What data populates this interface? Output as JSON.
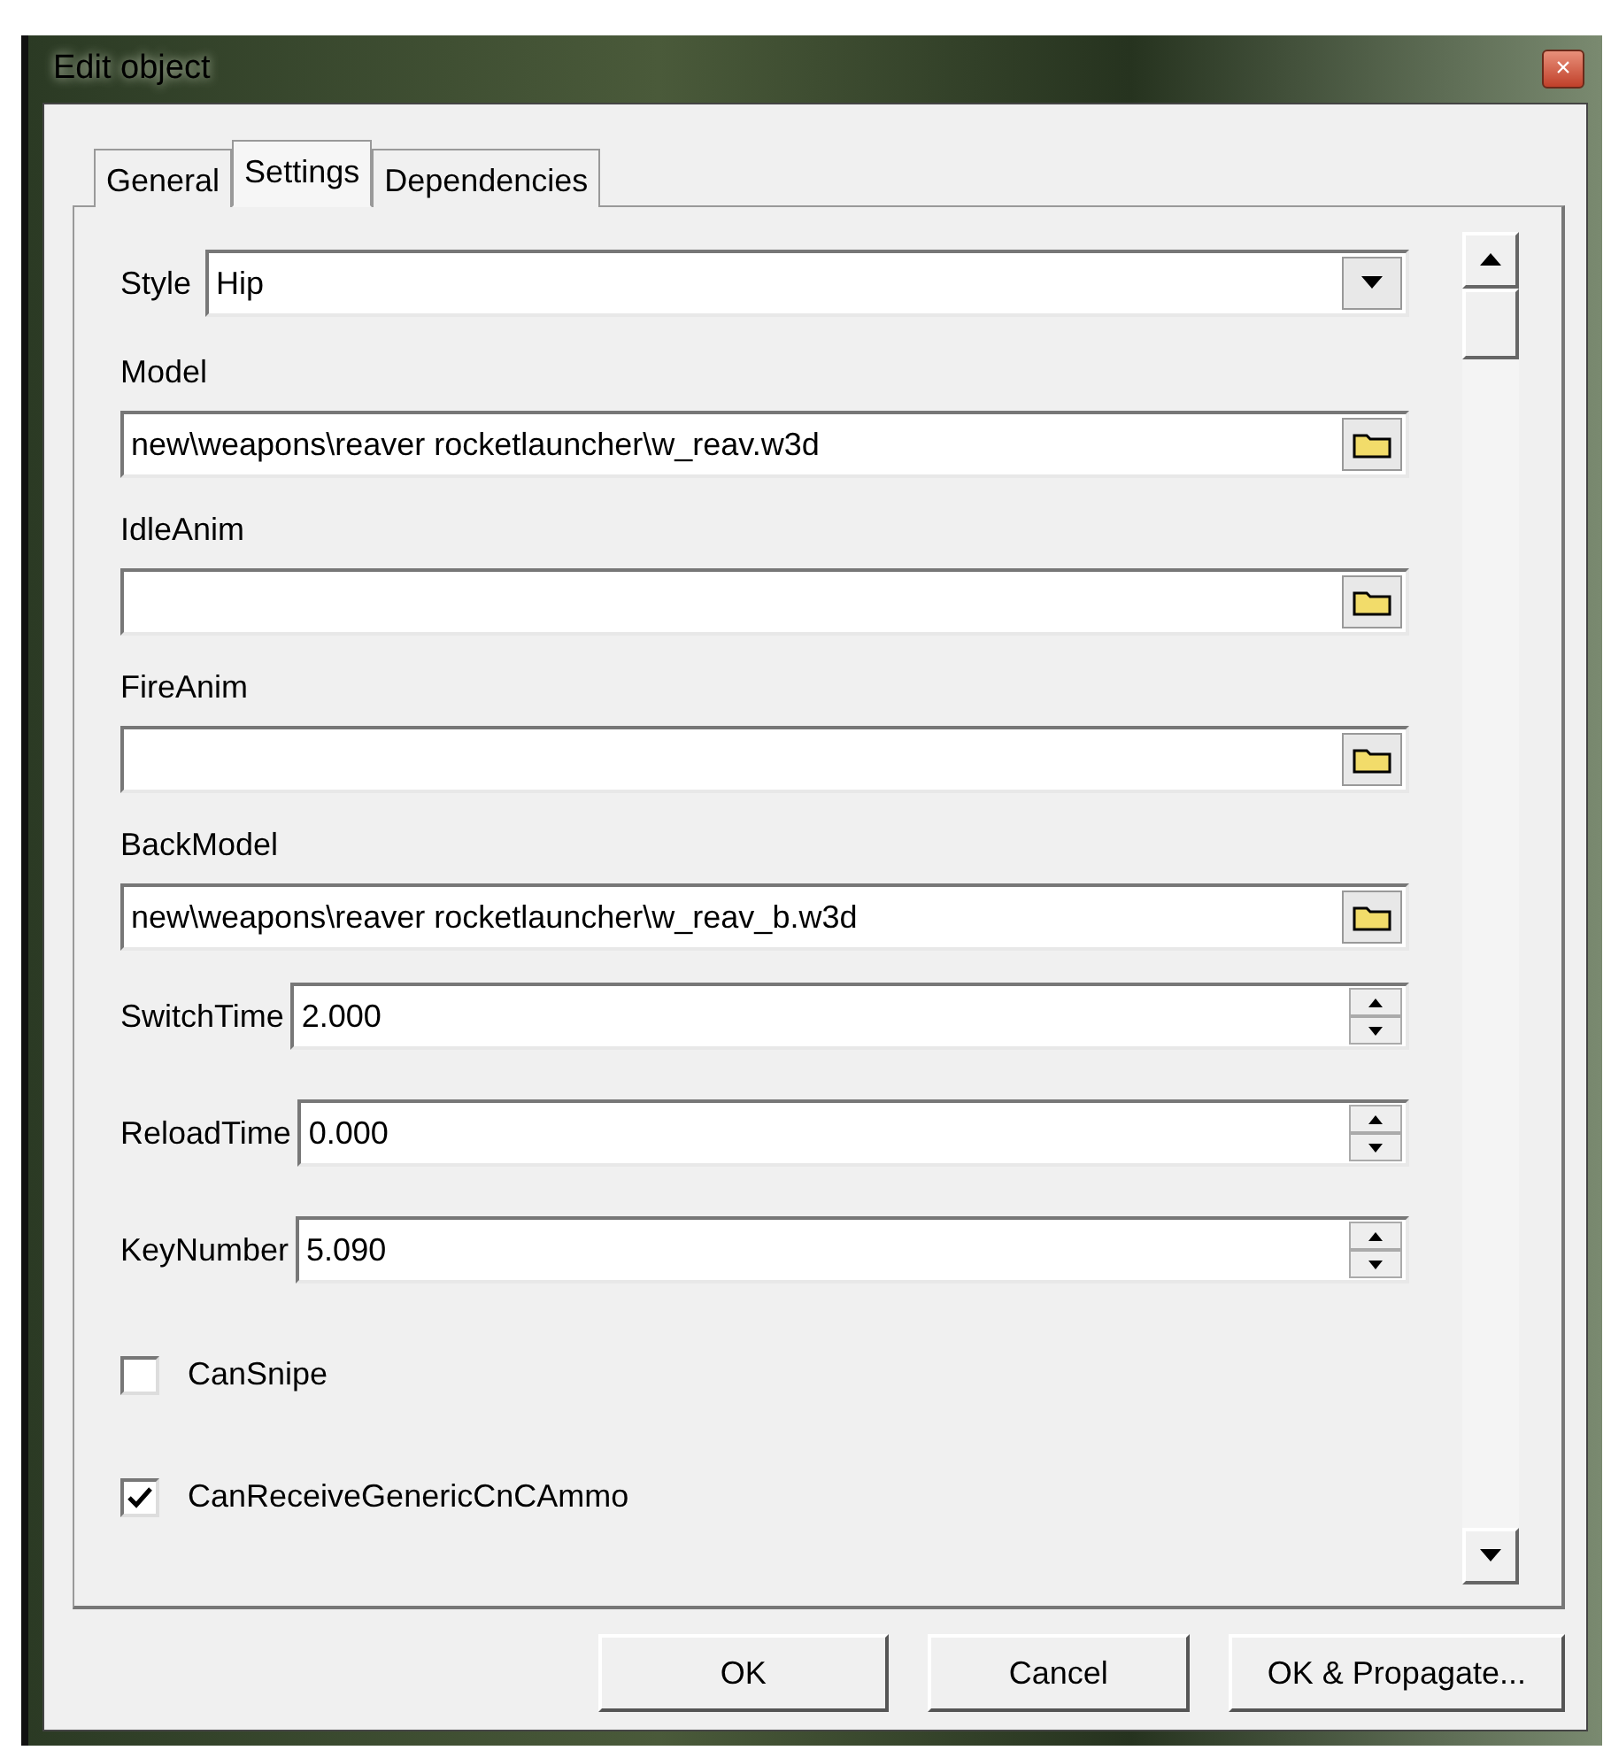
{
  "window": {
    "title": "Edit object",
    "close": "×"
  },
  "tabs": [
    {
      "label": "General",
      "selected": false
    },
    {
      "label": "Settings",
      "selected": true
    },
    {
      "label": "Dependencies",
      "selected": false
    }
  ],
  "fields": [
    {
      "kind": "dropdown",
      "label": "Style",
      "value": "Hip"
    },
    {
      "kind": "file",
      "label": "Model",
      "value": "new\\weapons\\reaver rocketlauncher\\w_reav.w3d"
    },
    {
      "kind": "file",
      "label": "IdleAnim"
    },
    {
      "kind": "file",
      "label": "FireAnim"
    },
    {
      "kind": "file",
      "label": "BackModel",
      "value": "new\\weapons\\reaver rocketlauncher\\w_reav_b.w3d"
    },
    {
      "kind": "spin",
      "label": "SwitchTime",
      "value": "2.000"
    },
    {
      "kind": "spin",
      "label": "ReloadTime",
      "value": "0.000"
    },
    {
      "kind": "spin",
      "label": "KeyNumber",
      "value": "5.090"
    },
    {
      "kind": "checkbox",
      "label": "CanSnipe",
      "checked": false
    },
    {
      "kind": "checkbox",
      "label": "CanReceiveGenericCnCAmmo",
      "checked": true
    }
  ],
  "buttons": [
    "OK",
    "Cancel",
    "OK & Propagate..."
  ]
}
